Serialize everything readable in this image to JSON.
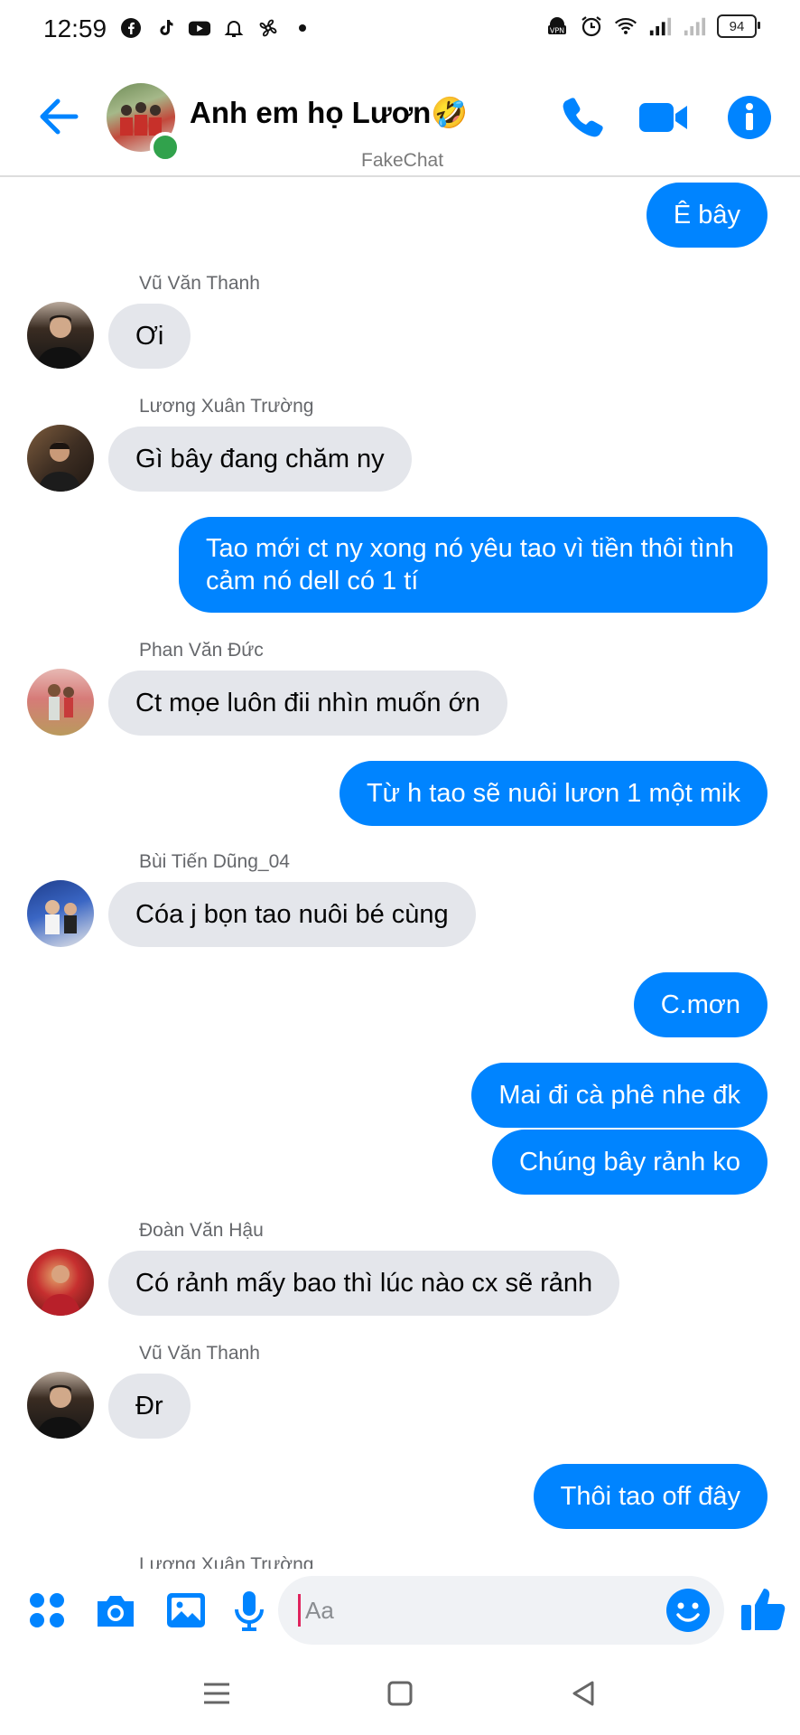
{
  "status_bar": {
    "time": "12:59",
    "battery": "94",
    "left_icons": [
      "facebook-icon",
      "tiktok-icon",
      "youtube-icon",
      "bell-icon",
      "pinwheel-icon",
      "dot-icon"
    ],
    "right_icons": [
      "vpn-icon",
      "alarm-icon",
      "wifi-icon",
      "signal-icon",
      "signal-icon",
      "battery-icon"
    ]
  },
  "header": {
    "title": "Anh em họ Lươn🤣",
    "watermark": "FakeChat",
    "icons": [
      "back-arrow-icon",
      "phone-icon",
      "video-camera-icon",
      "info-icon"
    ]
  },
  "messages": [
    {
      "dir": "out",
      "text": "Ê bây"
    },
    {
      "dir": "in",
      "sender": "Vũ Văn Thanh",
      "text": "Ơi"
    },
    {
      "dir": "in",
      "sender": "Lương Xuân Trường",
      "text": "Gì bây đang chăm ny"
    },
    {
      "dir": "out",
      "text": "Tao mới ct ny xong nó yêu tao vì tiền thôi tình cảm nó dell có 1 tí"
    },
    {
      "dir": "in",
      "sender": "Phan Văn Đức",
      "text": "Ct mọe luôn đii nhìn muốn ớn"
    },
    {
      "dir": "out",
      "text": "Từ h tao sẽ nuôi lươn 1 một mik"
    },
    {
      "dir": "in",
      "sender": "Bùi Tiến Dũng_04",
      "text": "Cóa j bọn tao nuôi bé cùng"
    },
    {
      "dir": "out",
      "text": "C.mơn"
    },
    {
      "dir": "out",
      "text": "Mai đi cà phê nhe đk"
    },
    {
      "dir": "out",
      "text": "Chúng bây rảnh ko"
    },
    {
      "dir": "in",
      "sender": "Đoàn Văn Hậu",
      "text": "Có rảnh mấy bao thì lúc nào cx sẽ rảnh"
    },
    {
      "dir": "in",
      "sender": "Vũ Văn Thanh",
      "text": "Đr"
    },
    {
      "dir": "out",
      "text": "Thôi tao off đây"
    },
    {
      "dir": "in",
      "sender": "Lương Xuân Trường"
    }
  ],
  "composer": {
    "placeholder": "Aa",
    "icons": [
      "apps-grid-icon",
      "camera-icon",
      "gallery-icon",
      "microphone-icon",
      "emoji-icon",
      "thumbs-up-icon"
    ]
  },
  "colors": {
    "accent": "#0084ff",
    "incoming_bubble": "#e4e6eb",
    "online": "#31a24c"
  },
  "nav_bar": {
    "icons": [
      "menu-icon",
      "home-square-icon",
      "back-triangle-icon"
    ]
  }
}
